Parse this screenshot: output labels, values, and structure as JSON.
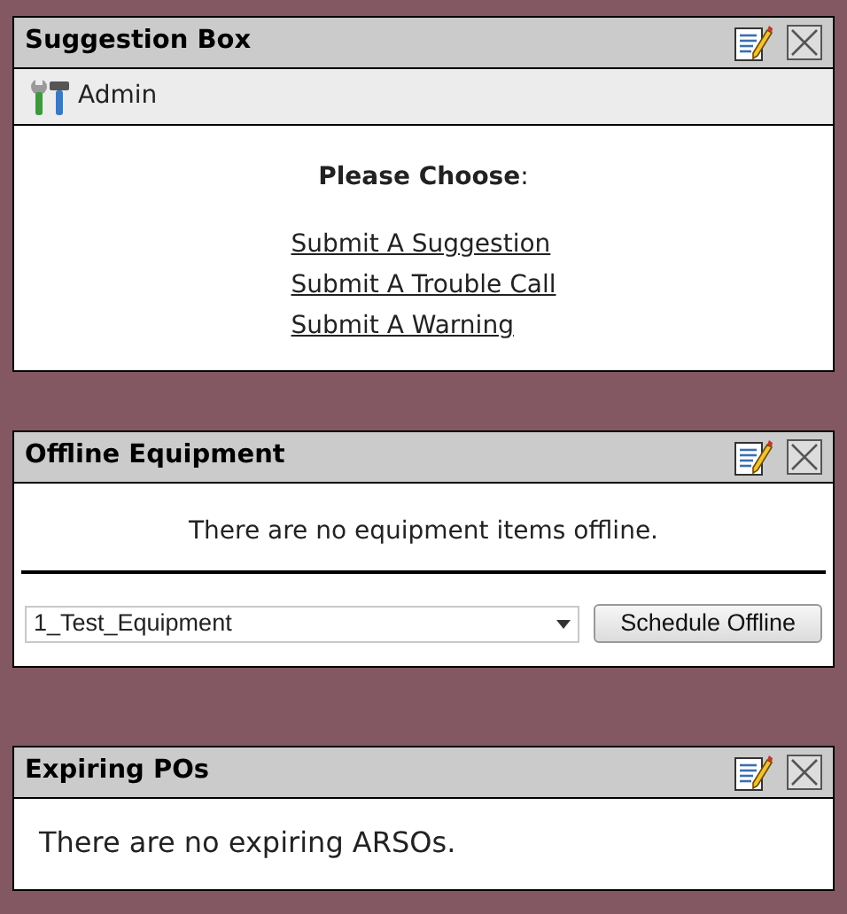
{
  "panels": [
    {
      "kind": "suggestion",
      "title": "Suggestion Box",
      "toolbar_label": "Admin",
      "heading": "**Please Choose**:",
      "links": [
        "Submit A Suggestion",
        "Submit A Trouble Call",
        "Submit A Warning"
      ]
    },
    {
      "kind": "offline",
      "title": "Offline Equipment",
      "message": "There are no equipment items offline.",
      "select_value": "1_Test_Equipment",
      "button": "Schedule Offline"
    },
    {
      "kind": "expiring",
      "title": "Expiring POs",
      "message": "There are no expiring ARSOs."
    }
  ]
}
